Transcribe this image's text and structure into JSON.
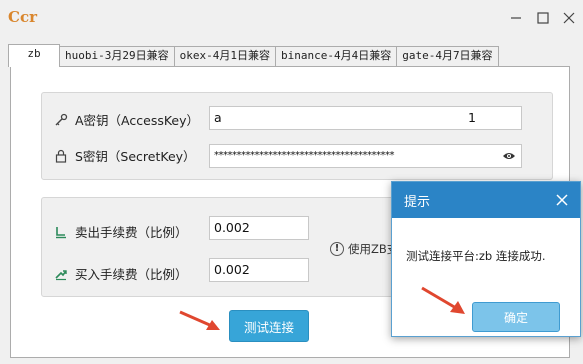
{
  "window": {
    "logo_text": "Ccr",
    "controls": [
      "minimize-icon",
      "maximize-icon",
      "close-icon"
    ]
  },
  "tabs": [
    {
      "label": "zb",
      "active": true
    },
    {
      "label": "huobi-3月29日兼容",
      "active": false
    },
    {
      "label": "okex-4月1日兼容",
      "active": false
    },
    {
      "label": "binance-4月4日兼容",
      "active": false
    },
    {
      "label": "gate-4月7日兼容",
      "active": false
    }
  ],
  "keys": {
    "access_label": "A密钥（AccessKey）",
    "access_value": "a                                                              1",
    "access_icon": "key-icon",
    "secret_label": "S密钥（SecretKey）",
    "secret_value": "****************************************",
    "secret_icon": "lock-icon",
    "reveal_icon": "eye-icon"
  },
  "fees": {
    "sell_label": "卖出手续费（比例）",
    "sell_value": "0.002",
    "sell_icon": "sell-icon",
    "buy_label": "买入手续费（比例）",
    "buy_value": "0.002",
    "buy_icon": "buy-icon",
    "hint_text": "使用ZB支"
  },
  "test_button_label": "测试连接",
  "dialog": {
    "title": "提示",
    "message": "测试连接平台:zb  连接成功.",
    "ok_label": "确定"
  },
  "colors": {
    "accent": "#2b84c6",
    "button": "#37a5d8",
    "arrow": "#e0472f"
  }
}
